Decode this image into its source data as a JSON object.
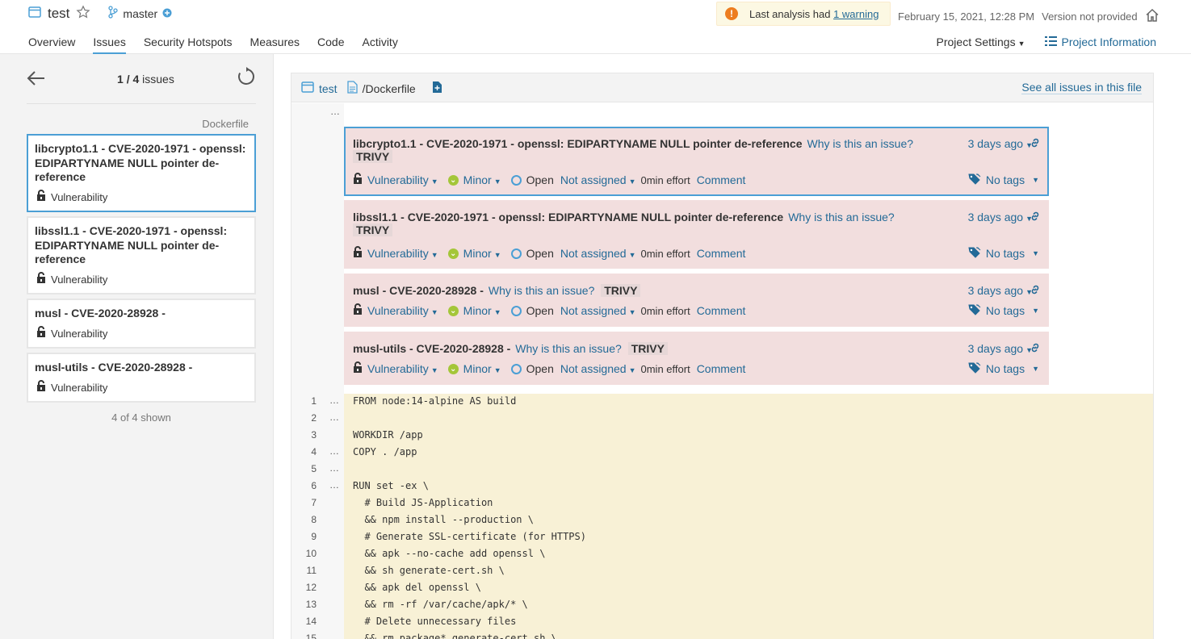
{
  "header": {
    "project_name": "test",
    "branch_name": "master",
    "warning_prefix": "Last analysis had ",
    "warning_link": "1 warning",
    "analysis_date": "February 15, 2021, 12:28 PM",
    "version": "Version not provided"
  },
  "nav": {
    "tabs": [
      "Overview",
      "Issues",
      "Security Hotspots",
      "Measures",
      "Code",
      "Activity"
    ],
    "active_tab": "Issues",
    "project_settings": "Project Settings",
    "project_information": "Project Information"
  },
  "sidebar": {
    "counter_current": "1",
    "counter_total": "/ 4",
    "counter_label": " issues",
    "file_label": "Dockerfile",
    "cards": [
      {
        "title": "libcrypto1.1 - CVE-2020-1971 - openssl: EDIPARTYNAME NULL pointer de-reference",
        "type": "Vulnerability"
      },
      {
        "title": "libssl1.1 - CVE-2020-1971 - openssl: EDIPARTYNAME NULL pointer de-reference",
        "type": "Vulnerability"
      },
      {
        "title": "musl - CVE-2020-28928 -",
        "type": "Vulnerability"
      },
      {
        "title": "musl-utils - CVE-2020-28928 -",
        "type": "Vulnerability"
      }
    ],
    "footer": "4 of 4 shown"
  },
  "viewer": {
    "crumb_project": "test",
    "crumb_file": "/Dockerfile",
    "see_all": "See all issues in this file",
    "top_ellipsis": "…"
  },
  "issues": [
    {
      "title": "libcrypto1.1 - CVE-2020-1971 - openssl: EDIPARTYNAME NULL pointer de-reference",
      "why": "Why is this an issue?",
      "tag": "TRIVY",
      "age": "3 days ago",
      "type": "Vulnerability",
      "severity": "Minor",
      "status": "Open",
      "assignee": "Not assigned",
      "effort": "0min effort",
      "comment": "Comment",
      "tags": "No tags"
    },
    {
      "title": "libssl1.1 - CVE-2020-1971 - openssl: EDIPARTYNAME NULL pointer de-reference",
      "why": "Why is this an issue?",
      "tag": "TRIVY",
      "age": "3 days ago",
      "type": "Vulnerability",
      "severity": "Minor",
      "status": "Open",
      "assignee": "Not assigned",
      "effort": "0min effort",
      "comment": "Comment",
      "tags": "No tags"
    },
    {
      "title": "musl - CVE-2020-28928 -",
      "why": "Why is this an issue?",
      "tag": "TRIVY",
      "age": "3 days ago",
      "type": "Vulnerability",
      "severity": "Minor",
      "status": "Open",
      "assignee": "Not assigned",
      "effort": "0min effort",
      "comment": "Comment",
      "tags": "No tags"
    },
    {
      "title": "musl-utils - CVE-2020-28928 -",
      "why": "Why is this an issue?",
      "tag": "TRIVY",
      "age": "3 days ago",
      "type": "Vulnerability",
      "severity": "Minor",
      "status": "Open",
      "assignee": "Not assigned",
      "effort": "0min effort",
      "comment": "Comment",
      "tags": "No tags"
    }
  ],
  "code": [
    {
      "n": "1",
      "dots": "…",
      "text": "FROM node:14-alpine AS build"
    },
    {
      "n": "2",
      "dots": "…",
      "text": ""
    },
    {
      "n": "3",
      "dots": "",
      "text": "WORKDIR /app"
    },
    {
      "n": "4",
      "dots": "…",
      "text": "COPY . /app"
    },
    {
      "n": "5",
      "dots": "…",
      "text": ""
    },
    {
      "n": "6",
      "dots": "…",
      "text": "RUN set -ex \\"
    },
    {
      "n": "7",
      "dots": "",
      "text": "  # Build JS-Application"
    },
    {
      "n": "8",
      "dots": "",
      "text": "  && npm install --production \\"
    },
    {
      "n": "9",
      "dots": "",
      "text": "  # Generate SSL-certificate (for HTTPS)"
    },
    {
      "n": "10",
      "dots": "",
      "text": "  && apk --no-cache add openssl \\"
    },
    {
      "n": "11",
      "dots": "",
      "text": "  && sh generate-cert.sh \\"
    },
    {
      "n": "12",
      "dots": "",
      "text": "  && apk del openssl \\"
    },
    {
      "n": "13",
      "dots": "",
      "text": "  && rm -rf /var/cache/apk/* \\"
    },
    {
      "n": "14",
      "dots": "",
      "text": "  # Delete unnecessary files"
    },
    {
      "n": "15",
      "dots": "",
      "text": "  && rm package* generate-cert.sh \\"
    }
  ]
}
